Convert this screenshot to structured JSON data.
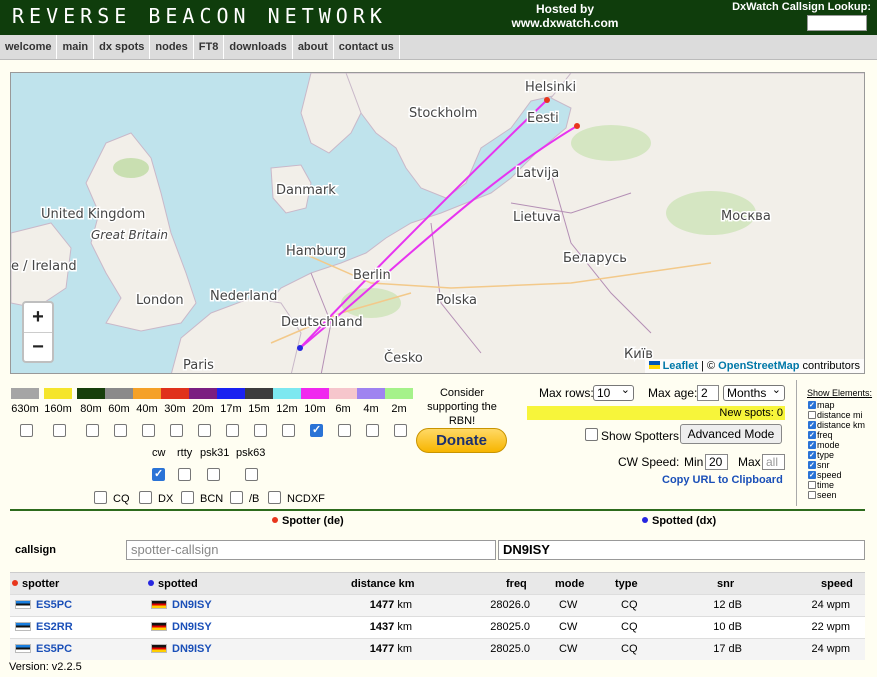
{
  "header": {
    "logo": "REVERSE BEACON NETWORK",
    "hosted_line1": "Hosted by",
    "hosted_line2": "www.dxwatch.com",
    "lookup_label": "DxWatch Callsign Lookup:"
  },
  "nav": [
    "welcome",
    "main",
    "dx spots",
    "nodes",
    "FT8",
    "downloads",
    "about",
    "contact us"
  ],
  "map": {
    "labels": {
      "helsinki": "Helsinki",
      "stockholm": "Stockholm",
      "eesti": "Eesti",
      "latvija": "Latvija",
      "danmark": "Danmark",
      "lietuva": "Lietuva",
      "moskva": "Москва",
      "uk": "United Kingdom",
      "gb": "Great Britain",
      "ireland": "e / Ireland",
      "hamburg": "Hamburg",
      "berlin": "Berlin",
      "belarus": "Беларусь",
      "nederland": "Nederland",
      "london": "London",
      "polska": "Polska",
      "deutschland": "Deutschland",
      "paris": "Paris",
      "cesko": "Česko",
      "kyiv": "Київ"
    },
    "zoom_in": "+",
    "zoom_out": "−",
    "attribution_leaflet": "Leaflet",
    "attribution_sep": " | © ",
    "attribution_osm": "OpenStreetMap",
    "attribution_suffix": " contributors"
  },
  "bands": [
    {
      "label": "630m",
      "color": "#a5a5a5",
      "checked": false
    },
    {
      "label": "160m",
      "color": "#f5e52a",
      "checked": false
    },
    {
      "label": "80m",
      "color": "#173f0b",
      "checked": false
    },
    {
      "label": "60m",
      "color": "#8a8a8a",
      "checked": false
    },
    {
      "label": "40m",
      "color": "#f5a127",
      "checked": false
    },
    {
      "label": "30m",
      "color": "#e0321b",
      "checked": false
    },
    {
      "label": "20m",
      "color": "#7b1f80",
      "checked": false
    },
    {
      "label": "17m",
      "color": "#1a22f0",
      "checked": false
    },
    {
      "label": "15m",
      "color": "#3d3d3d",
      "checked": false
    },
    {
      "label": "12m",
      "color": "#7de8f0",
      "checked": false
    },
    {
      "label": "10m",
      "color": "#f028ef",
      "checked": true
    },
    {
      "label": "6m",
      "color": "#f6c6cc",
      "checked": false
    },
    {
      "label": "4m",
      "color": "#9f83f0",
      "checked": false
    },
    {
      "label": "2m",
      "color": "#a5f28a",
      "checked": false
    }
  ],
  "modes": [
    {
      "label": "cw",
      "checked": true
    },
    {
      "label": "rtty",
      "checked": false
    },
    {
      "label": "psk31",
      "checked": false
    },
    {
      "label": "psk63",
      "checked": false
    }
  ],
  "types": [
    {
      "label": "CQ",
      "checked": false
    },
    {
      "label": "DX",
      "checked": false
    },
    {
      "label": "BCN",
      "checked": false
    },
    {
      "label": "/B",
      "checked": false
    },
    {
      "label": "NCDXF",
      "checked": false
    }
  ],
  "support": {
    "text": "Consider supporting the RBN!",
    "donate": "Donate"
  },
  "controls": {
    "max_rows_label": "Max rows:",
    "max_rows_value": "10",
    "max_age_label": "Max age:",
    "max_age_value": "2",
    "max_age_unit": "Months",
    "new_spots": "New spots: 0",
    "show_spotters": "Show Spotters",
    "advanced_mode": "Advanced Mode",
    "cw_speed_label": "CW Speed:",
    "min_label": "Min",
    "min_value": "20",
    "max_label": "Max",
    "max_placeholder": "all",
    "copy_url": "Copy URL to Clipboard"
  },
  "show_elements": {
    "title": "Show Elements:",
    "items": [
      {
        "label": "map",
        "checked": true
      },
      {
        "label": "distance mi",
        "checked": false
      },
      {
        "label": "distance km",
        "checked": true
      },
      {
        "label": "freq",
        "checked": true
      },
      {
        "label": "mode",
        "checked": true
      },
      {
        "label": "type",
        "checked": true
      },
      {
        "label": "snr",
        "checked": true
      },
      {
        "label": "speed",
        "checked": true
      },
      {
        "label": "time",
        "checked": false
      },
      {
        "label": "seen",
        "checked": false
      }
    ]
  },
  "filter": {
    "spotter_header": "Spotter (de)",
    "spotted_header": "Spotted (dx)",
    "callsign_label": "callsign",
    "spotter_placeholder": "spotter-callsign",
    "spotted_value": "DN9ISY"
  },
  "table": {
    "columns": {
      "spotter": "spotter",
      "spotted": "spotted",
      "distance": "distance km",
      "freq": "freq",
      "mode": "mode",
      "type": "type",
      "snr": "snr",
      "speed": "speed"
    },
    "rows": [
      {
        "spotter": "ES5PC",
        "spotted": "DN9ISY",
        "distance": "1477",
        "unit": " km",
        "freq": "28026.0",
        "mode": "CW",
        "type": "CQ",
        "snr": "12 dB",
        "speed": "24 wpm"
      },
      {
        "spotter": "ES2RR",
        "spotted": "DN9ISY",
        "distance": "1437",
        "unit": " km",
        "freq": "28025.0",
        "mode": "CW",
        "type": "CQ",
        "snr": "10 dB",
        "speed": "22 wpm"
      },
      {
        "spotter": "ES5PC",
        "spotted": "DN9ISY",
        "distance": "1477",
        "unit": " km",
        "freq": "28025.0",
        "mode": "CW",
        "type": "CQ",
        "snr": "17 dB",
        "speed": "24 wpm"
      }
    ]
  },
  "version": "Version: v2.2.5"
}
